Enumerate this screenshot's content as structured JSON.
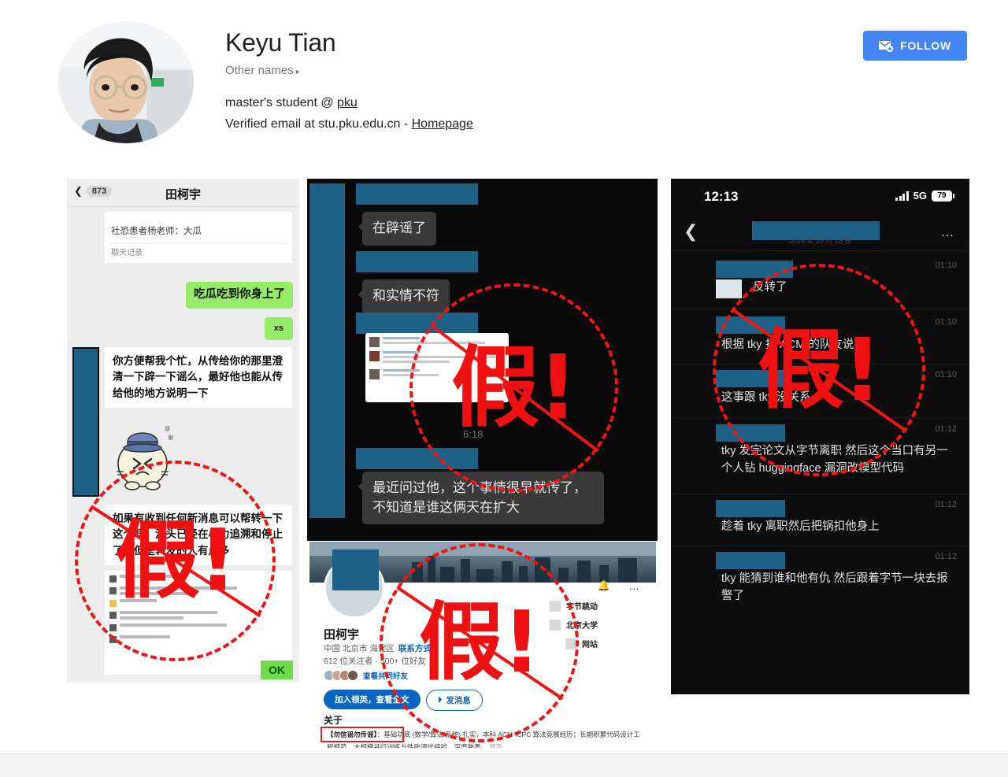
{
  "profile": {
    "name": "Keyu Tian",
    "other_names_label": "Other names",
    "other_names_caret": "▸",
    "affiliation_prefix": "master's student @ ",
    "affiliation_link": "pku",
    "email_text": "Verified email at stu.pku.edu.cn - ",
    "homepage_link": "Homepage",
    "follow_label": "FOLLOW",
    "follow_icon": "mail-add-icon",
    "follow_color": "#4285f4"
  },
  "stamps": {
    "glyph": "假!",
    "color": "#ef1111",
    "names": [
      "fake-stamp-left",
      "fake-stamp-middle",
      "fake-stamp-right",
      "fake-stamp-bottom"
    ]
  },
  "wechat_panel": {
    "back_icon": "chevron-left-icon",
    "unread_count": "873",
    "title": "田柯宇",
    "quote_card": {
      "clipped_line": "社恐患者杨老师：大瓜",
      "footer": "聊天记录"
    },
    "messages": [
      {
        "id": "wx-msg1",
        "side": "right",
        "text": "吃瓜吃到你身上了"
      },
      {
        "id": "wx-msg2",
        "side": "right",
        "text": "xs"
      },
      {
        "id": "wx-bubble-white1",
        "side": "left",
        "text": "你方便帮我个忙，从传给你的那里澄清一下辟一下谣么，最好他也能从传给他的地方说明一下"
      },
      {
        "id": "wx-bubble-white2",
        "side": "left",
        "text": "如果有收到任何新消息可以帮转一下这个吗，源头已经在尽力追溯和停止了，但是转发的人有点多"
      }
    ],
    "sticker_name": "cat-sticker",
    "ok_reaction": "OK"
  },
  "dark_panel": {
    "avatar_name": "redacted-avatar",
    "bubbles": [
      {
        "text": "在辟谣了"
      },
      {
        "text": "和实情不符"
      },
      {
        "text": "最近问过他，这个事情很早就传了，不知道是谁这俩天在扩大"
      }
    ],
    "timestamp": "6:18",
    "embedded_card_name": "forwarded-chat-card"
  },
  "right_panel": {
    "status_bar": {
      "time": "12:13",
      "signal_icon": "cellular-bars-icon",
      "network": "5G",
      "battery": "79"
    },
    "nav": {
      "back_icon": "chevron-left-icon",
      "title_redacted": "redacted-contact-name",
      "date_label": "2024 年 10 月 18 日",
      "more_icon": "ellipsis-icon"
    },
    "messages": [
      {
        "time": "01:10",
        "text": "反转了",
        "has_thumb": true
      },
      {
        "time": "01:10",
        "text": "根据 tky 打 ACM 的队友说",
        "has_thumb": false
      },
      {
        "time": "01:10",
        "text": "这事跟 tky 没关系",
        "has_thumb": false
      },
      {
        "time": "01:12",
        "text": "tky 发完论文从字节离职 然后这个当口有另一个人钻 huggingface 漏洞改模型代码",
        "has_thumb": false
      },
      {
        "time": "01:12",
        "text": "趁着 tky 离职然后把锅扣他身上",
        "has_thumb": false
      },
      {
        "time": "01:12",
        "text": "tky 能猜到谁和他有仇 然后跟着字节一块去报警了",
        "has_thumb": false
      }
    ]
  },
  "linkedin_panel": {
    "cover_name": "city-skyline-cover",
    "avatar_name": "redacted-profile-photo",
    "bell_icon": "bell-icon",
    "more_icon": "ellipsis-icon",
    "name": "田柯宇",
    "location": "中国 北京市 海淀区",
    "contact_link": "联系方式",
    "stats": "612 位关注者 · 500+ 位好友",
    "mutual_label": "查看共同好友",
    "primary_button": "加入领英，查看全文",
    "secondary_button": "发消息",
    "secondary_icon": "send-icon",
    "organizations": [
      {
        "name": "字节跳动",
        "logo": "bytedance-logo"
      },
      {
        "name": "北京大学",
        "logo": "pku-logo"
      },
      {
        "name": "网站",
        "logo": "website-icon"
      }
    ],
    "about_title": "关于",
    "about_highlight": "【勿信谣勿传谣】",
    "about_text": "：基础功底 (数学/算法/系统) 扎实，本科 ACM-ICPC 算法竞赛经历；长期积累代码设计工程规范、大规模并行训练与性能调优经验，深度熟悉…",
    "about_more": "显示"
  }
}
